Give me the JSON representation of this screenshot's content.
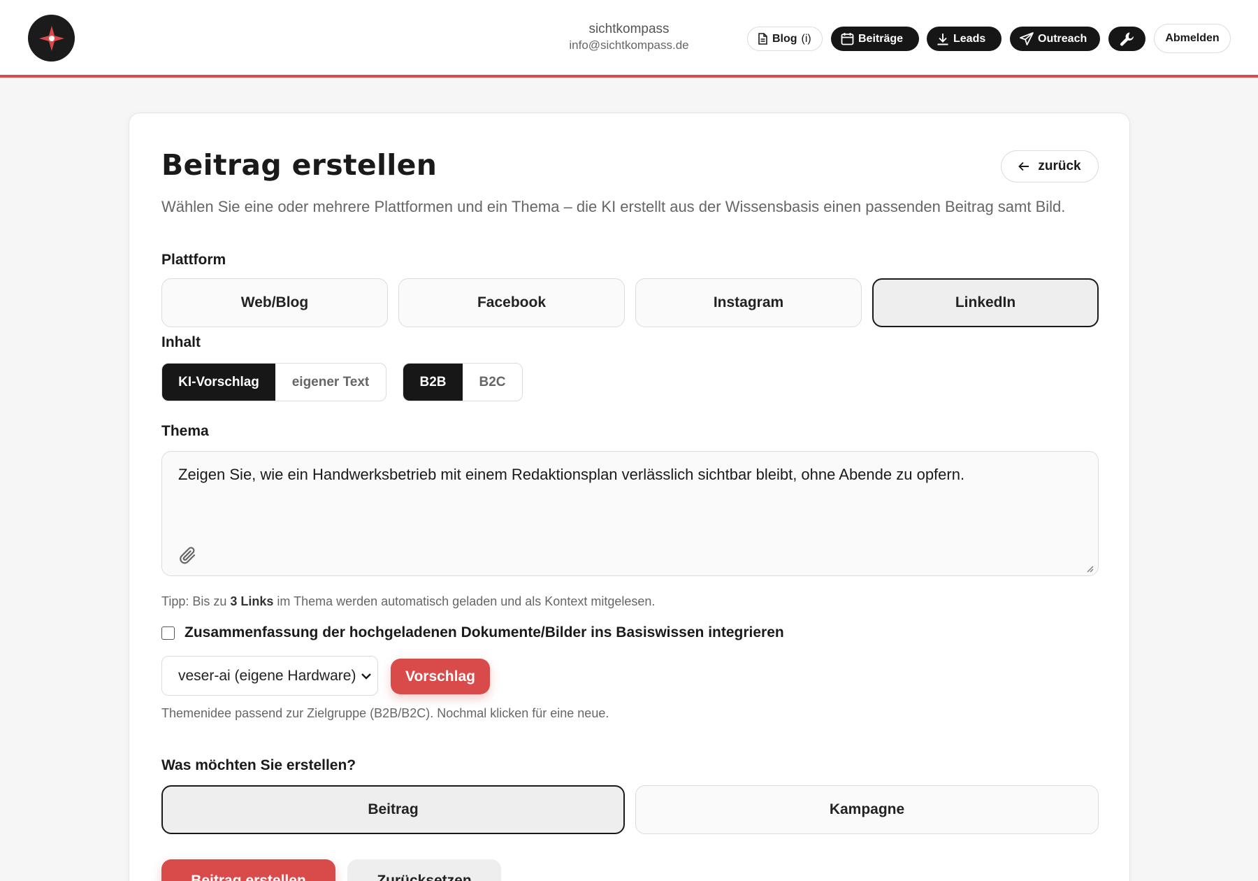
{
  "header": {
    "account_name": "sichtkompass",
    "account_email": "info@sichtkompass.de",
    "nav": {
      "blog": "Blog",
      "blog_suffix": "(i)",
      "beitraege": "Beiträge",
      "leads": "Leads",
      "outreach": "Outreach",
      "logout": "Abmelden"
    },
    "brand_color": "#d94a4a"
  },
  "page": {
    "title": "Beitrag erstellen",
    "back_label": "zurück",
    "intro": "Wählen Sie eine oder mehrere Plattformen und ein Thema – die KI erstellt aus der Wissensbasis einen passenden Beitrag samt Bild."
  },
  "platform": {
    "label": "Plattform",
    "options": [
      "Web/Blog",
      "Facebook",
      "Instagram",
      "LinkedIn"
    ],
    "selected": "LinkedIn"
  },
  "content": {
    "label": "Inhalt",
    "source_options": [
      "KI-Vorschlag",
      "eigener Text"
    ],
    "source_selected": "KI-Vorschlag",
    "audience_options": [
      "B2B",
      "B2C"
    ],
    "audience_selected": "B2B"
  },
  "topic": {
    "label": "Thema",
    "value": "Zeigen Sie, wie ein Handwerksbetrieb mit einem Redaktionsplan verlässlich sichtbar bleibt, ohne Abende zu opfern.",
    "tip_prefix": "Tipp: Bis zu ",
    "tip_bold": "3 Links",
    "tip_suffix": " im Thema werden automatisch geladen und als Kontext mitgelesen."
  },
  "integrate_checkbox": {
    "label": "Zusammenfassung der hochgeladenen Dokumente/Bilder ins Basiswissen integrieren",
    "checked": false
  },
  "model": {
    "selected": "veser-ai (eigene Hardware)",
    "suggest_label": "Vorschlag",
    "note": "Themenidee passend zur Zielgruppe (B2B/B2C). Nochmal klicken für eine neue."
  },
  "create_type": {
    "label": "Was möchten Sie erstellen?",
    "options": [
      "Beitrag",
      "Kampagne"
    ],
    "selected": "Beitrag"
  },
  "actions": {
    "submit": "Beitrag erstellen",
    "reset": "Zurücksetzen"
  }
}
